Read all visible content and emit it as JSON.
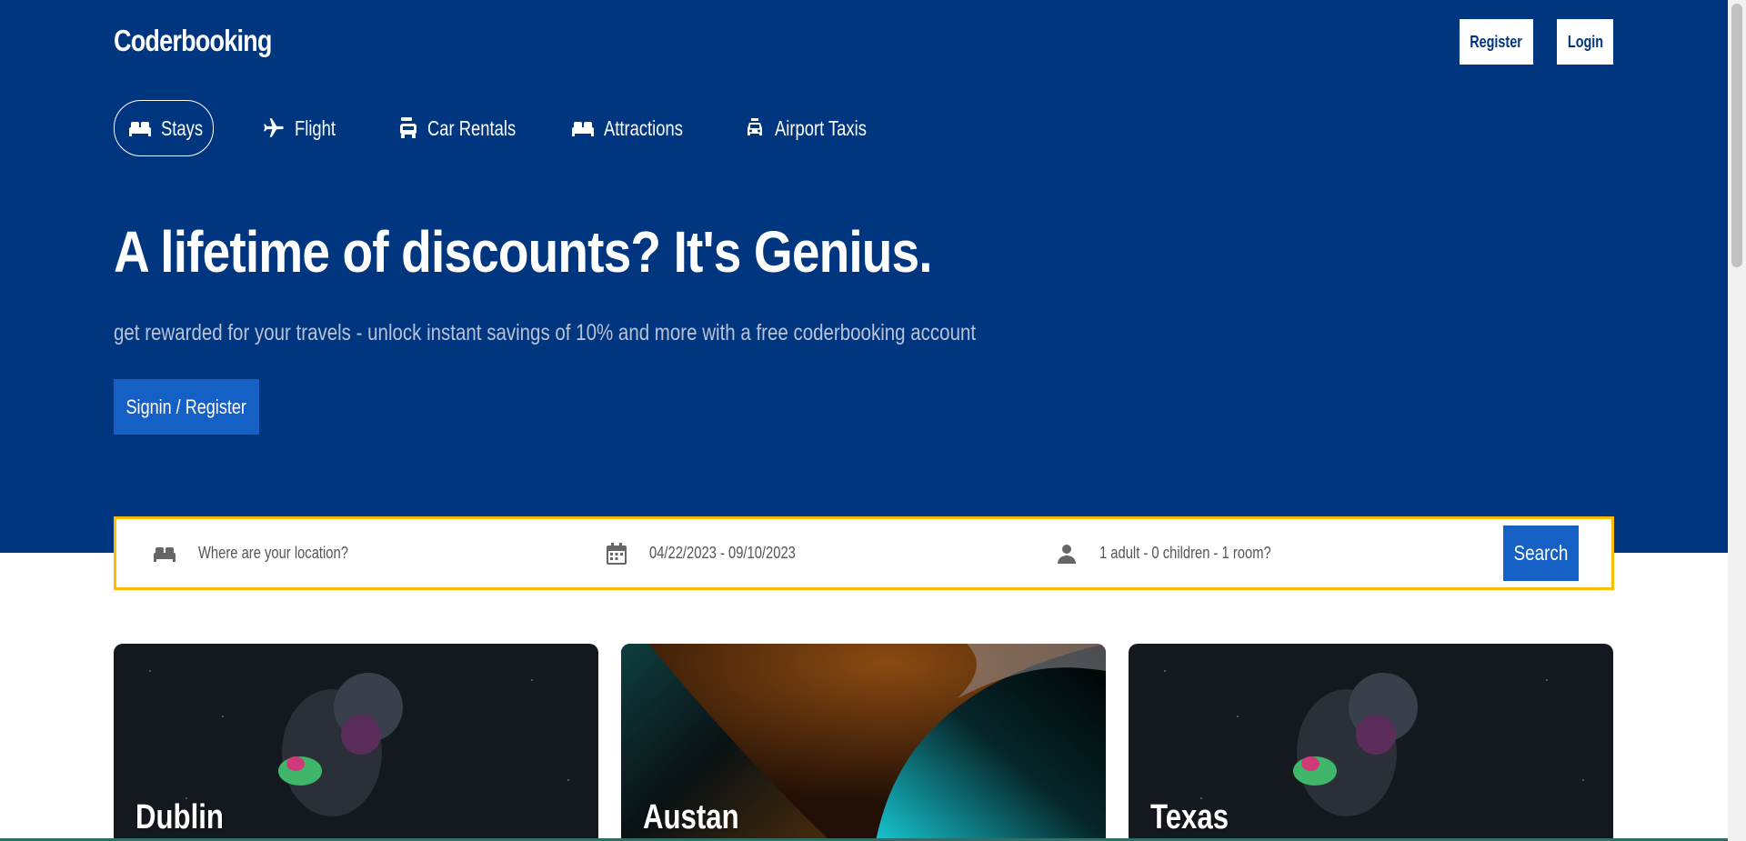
{
  "header": {
    "brand": "Coderbooking",
    "register_label": "Register",
    "login_label": "Login"
  },
  "nav": {
    "items": [
      {
        "label": "Stays",
        "icon": "bed-icon",
        "active": true
      },
      {
        "label": "Flight",
        "icon": "plane-icon"
      },
      {
        "label": "Car Rentals",
        "icon": "car-icon"
      },
      {
        "label": "Attractions",
        "icon": "bed-icon"
      },
      {
        "label": "Airport Taxis",
        "icon": "taxi-icon"
      }
    ]
  },
  "hero": {
    "title": "A lifetime of discounts? It's Genius.",
    "subtitle": "get rewarded for your travels - unlock instant savings of 10% and more with a free coderbooking account",
    "cta_label": "Signin / Register"
  },
  "search": {
    "location_placeholder": "Where are your location?",
    "dates": "04/22/2023 - 09/10/2023",
    "guests": "1 adult - 0 children - 1 room?",
    "button_label": "Search"
  },
  "destinations": [
    {
      "city": "Dublin"
    },
    {
      "city": "Austan"
    },
    {
      "city": "Texas"
    }
  ],
  "colors": {
    "brand_blue": "#003580",
    "button_blue": "#1460c4",
    "search_border": "#febb02"
  }
}
